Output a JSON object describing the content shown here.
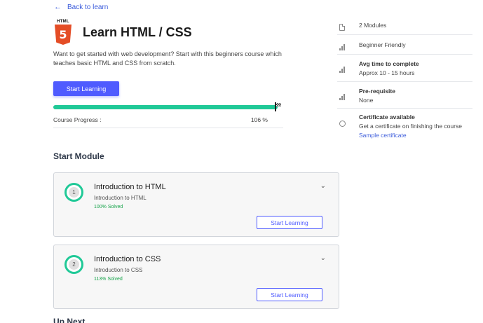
{
  "back_link": {
    "arrow": "←",
    "label": "Back to learn"
  },
  "course": {
    "logo_word": "HTML",
    "logo_number": "5",
    "title": "Learn HTML / CSS",
    "description": "Want to get started with web development? Start with this beginners course which teaches basic HTML and CSS from scratch.",
    "start_button": "Start Learning",
    "progress_label": "Course Progress :",
    "progress_text": "106 %",
    "progress_value": 1.0
  },
  "sections": {
    "start_module": "Start Module",
    "up_next": "Up Next"
  },
  "modules": [
    {
      "number": "1",
      "title": "Introduction to HTML",
      "subtitle": "Introduction to HTML",
      "solved": "100% Solved",
      "button": "Start Learning",
      "chevron": "⌄"
    },
    {
      "number": "2",
      "title": "Introduction to CSS",
      "subtitle": "Introduction to CSS",
      "solved": "113% Solved",
      "button": "Start Learning",
      "chevron": "⌄"
    }
  ],
  "sidebar": {
    "modules_count": "2 Modules",
    "level": "Beginner Friendly",
    "time_title": "Avg time to complete",
    "time_value": "Approx 10 - 15 hours",
    "prereq_title": "Pre-requisite",
    "prereq_value": "None",
    "cert_title": "Certificate available",
    "cert_desc": "Get a certificate on finishing the course",
    "cert_link": "Sample certificate"
  },
  "colors": {
    "accent": "#4f5bff",
    "progress": "#20c997",
    "link": "#3b5bdb",
    "solved": "#16a34a",
    "html5": "#e44d26"
  },
  "icons": [
    "arrow-left-icon",
    "html5-logo-icon",
    "document-icon",
    "signal-bars-icon",
    "certificate-icon",
    "chevron-down-icon",
    "finish-flag-icon"
  ]
}
